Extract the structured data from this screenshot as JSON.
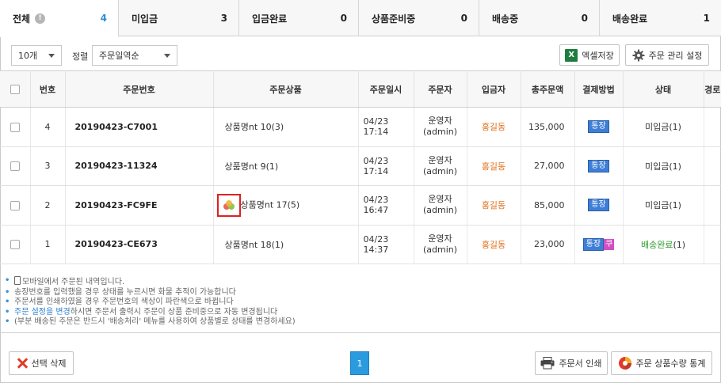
{
  "tabs": [
    {
      "label": "전체",
      "count": "4",
      "active": true
    },
    {
      "label": "미입금",
      "count": "3"
    },
    {
      "label": "입금완료",
      "count": "0"
    },
    {
      "label": "상품준비중",
      "count": "0"
    },
    {
      "label": "배송중",
      "count": "0"
    },
    {
      "label": "배송완료",
      "count": "1"
    }
  ],
  "toolbar": {
    "page_size": "10개",
    "sort_label": "정렬",
    "sort_value": "주문일역순",
    "excel_button": "엑셀저장",
    "settings_button": "주문 관리 설정"
  },
  "table": {
    "headers": [
      "번호",
      "주문번호",
      "주문상품",
      "주문일시",
      "주문자",
      "입금자",
      "총주문액",
      "결제방법",
      "상태",
      "경로"
    ],
    "rows": [
      {
        "no": "4",
        "order_no": "20190423-C7001",
        "product": "상품명nt 10(3)",
        "date": "04/23 17:14",
        "orderer": "운영자(admin)",
        "payer": "홍길동",
        "amount": "135,000",
        "pay": "통장",
        "pay2": "",
        "status": "미입금",
        "status_count": "(1)"
      },
      {
        "no": "3",
        "order_no": "20190423-11324",
        "product": "상품명nt 9(1)",
        "date": "04/23 17:14",
        "orderer": "운영자(admin)",
        "payer": "홍길동",
        "amount": "27,000",
        "pay": "통장",
        "pay2": "",
        "status": "미입금",
        "status_count": "(1)"
      },
      {
        "no": "2",
        "order_no": "20190423-FC9FE",
        "product": "상품명nt 17(5)",
        "date": "04/23 16:47",
        "orderer": "운영자(admin)",
        "payer": "홍길동",
        "amount": "85,000",
        "pay": "통장",
        "pay2": "",
        "status": "미입금",
        "status_count": "(1)"
      },
      {
        "no": "1",
        "order_no": "20190423-CE673",
        "product": "상품명nt 18(1)",
        "date": "04/23 14:37",
        "orderer": "운영자(admin)",
        "payer": "홍길동",
        "amount": "23,000",
        "pay": "통장",
        "pay2": "쿠",
        "status": "배송완료",
        "status_count": "(1)"
      }
    ]
  },
  "notes": {
    "n1": "모바일에서 주문된 내역입니다.",
    "n2": "송장번호를 입력했을 경우 상태를 누르시면 화물 추적이 가능합니다",
    "n3": "주문서를 인쇄하였을 경우 주문번호의 색상이 파란색으로 바뀝니다",
    "n4_link": "주문 설정을 변경",
    "n4_rest": "하시면 주문서 출력시 주문이 상품 준비중으로 자동 변경됩니다",
    "n5": "(부분 배송된 주문은 반드시 '배송처리' 메뉴를 사용하여 상품별로 상태를 변경하세요)"
  },
  "footer": {
    "delete_button": "선택 삭제",
    "page": "1",
    "print_button": "주문서 인쇄",
    "stats_button": "주문 상품수량 통계"
  },
  "colors": {
    "accent": "#2b9be0",
    "payer": "#e0701b",
    "done": "#2f9a2f"
  }
}
